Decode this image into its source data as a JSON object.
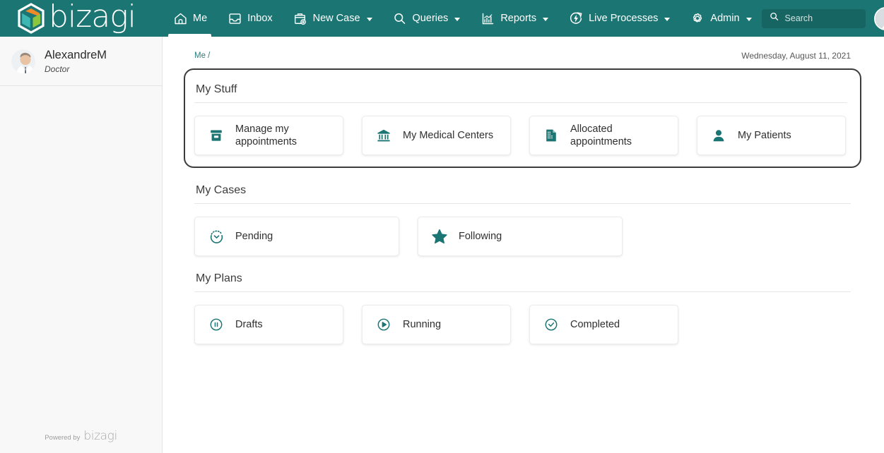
{
  "header": {
    "logo_text": "bizagi",
    "logo_icon": "bizagi-hexagon-logo",
    "nav": [
      {
        "label": "Me",
        "icon": "home-icon",
        "active": true,
        "has_caret": false
      },
      {
        "label": "Inbox",
        "icon": "inbox-tray-icon",
        "active": false,
        "has_caret": false
      },
      {
        "label": "New Case",
        "icon": "briefcase-plus-icon",
        "active": false,
        "has_caret": true
      },
      {
        "label": "Queries",
        "icon": "search-icon",
        "active": false,
        "has_caret": true
      },
      {
        "label": "Reports",
        "icon": "bar-chart-icon",
        "active": false,
        "has_caret": true
      },
      {
        "label": "Live Processes",
        "icon": "live-process-icon",
        "active": false,
        "has_caret": true
      },
      {
        "label": "Admin",
        "icon": "gear-icon",
        "active": false,
        "has_caret": true
      }
    ],
    "search": {
      "placeholder": "Search",
      "value": "",
      "icon": "search-icon"
    },
    "avatar": "user-avatar-photo"
  },
  "sidebar": {
    "user_name": "AlexandreM",
    "user_role": "Doctor",
    "avatar": "user-avatar-photo",
    "footer_prefix": "Powered by",
    "footer_logo": "bizagi"
  },
  "main": {
    "breadcrumb": "Me /",
    "date": "Wednesday, August 11, 2021",
    "sections": [
      {
        "title": "My Stuff",
        "focused": true,
        "tiles": [
          {
            "label": "Manage my appointments",
            "icon": "archive-box-icon"
          },
          {
            "label": "My Medical Centers",
            "icon": "bank-building-icon"
          },
          {
            "label": "Allocated appointments",
            "icon": "document-report-icon"
          },
          {
            "label": "My Patients",
            "icon": "user-person-icon"
          }
        ]
      },
      {
        "title": "My Cases",
        "focused": false,
        "tiles": [
          {
            "label": "Pending",
            "icon": "pending-clock-icon"
          },
          {
            "label": "Following",
            "icon": "star-filled-icon"
          }
        ]
      },
      {
        "title": "My Plans",
        "focused": false,
        "tiles": [
          {
            "label": "Drafts",
            "icon": "pause-circle-icon"
          },
          {
            "label": "Running",
            "icon": "play-circle-icon"
          },
          {
            "label": "Completed",
            "icon": "check-circle-icon"
          }
        ]
      }
    ]
  },
  "colors": {
    "brand_teal": "#1b7575",
    "icon_teal": "#1b7573",
    "search_bg": "#176563",
    "focus_border": "#3c3c3c",
    "sidebar_bg": "#f8f8f8",
    "logo_orange": "#f08a28",
    "logo_green": "#8cc63e",
    "logo_teal": "#3cb7b2"
  }
}
